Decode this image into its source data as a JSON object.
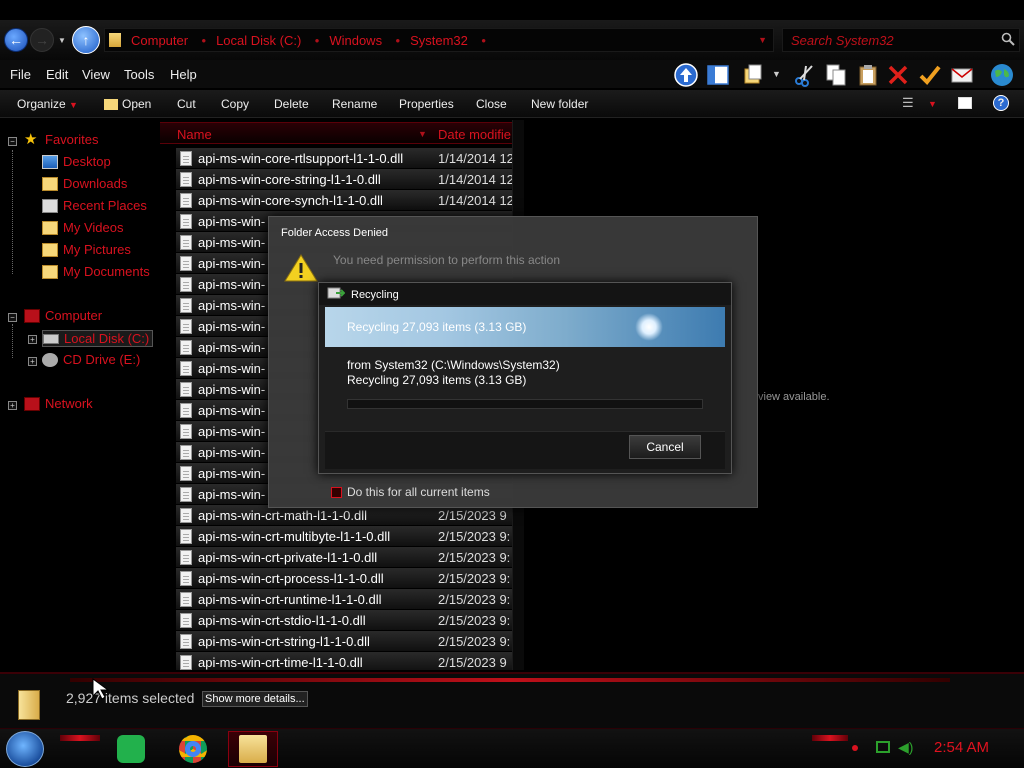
{
  "address": {
    "crumbs": [
      "Computer",
      "Local Disk (C:)",
      "Windows",
      "System32"
    ],
    "search_placeholder": "Search System32"
  },
  "menu": {
    "file": "File",
    "edit": "Edit",
    "view": "View",
    "tools": "Tools",
    "help": "Help"
  },
  "commands": {
    "organize": "Organize",
    "open": "Open",
    "cut": "Cut",
    "copy": "Copy",
    "delete": "Delete",
    "rename": "Rename",
    "properties": "Properties",
    "close": "Close",
    "new_folder": "New folder"
  },
  "nav": {
    "favorites": "Favorites",
    "desktop": "Desktop",
    "downloads": "Downloads",
    "recent_places": "Recent Places",
    "my_videos": "My Videos",
    "my_pictures": "My Pictures",
    "my_documents": "My Documents",
    "computer": "Computer",
    "local_disk": "Local Disk (C:)",
    "cd_drive": "CD Drive (E:)",
    "network": "Network"
  },
  "filelist": {
    "columns": {
      "name": "Name",
      "date": "Date modifie"
    },
    "rows": [
      {
        "name": "api-ms-win-core-rtlsupport-l1-1-0.dll",
        "date": "1/14/2014 12"
      },
      {
        "name": "api-ms-win-core-string-l1-1-0.dll",
        "date": "1/14/2014 12"
      },
      {
        "name": "api-ms-win-core-synch-l1-1-0.dll",
        "date": "1/14/2014 12"
      },
      {
        "name": "api-ms-win-",
        "date": ""
      },
      {
        "name": "api-ms-win-",
        "date": ""
      },
      {
        "name": "api-ms-win-",
        "date": ""
      },
      {
        "name": "api-ms-win-",
        "date": ""
      },
      {
        "name": "api-ms-win-",
        "date": ""
      },
      {
        "name": "api-ms-win-",
        "date": ""
      },
      {
        "name": "api-ms-win-",
        "date": ""
      },
      {
        "name": "api-ms-win-",
        "date": ""
      },
      {
        "name": "api-ms-win-",
        "date": ""
      },
      {
        "name": "api-ms-win-",
        "date": ""
      },
      {
        "name": "api-ms-win-",
        "date": ""
      },
      {
        "name": "api-ms-win-",
        "date": ""
      },
      {
        "name": "api-ms-win-",
        "date": ""
      },
      {
        "name": "api-ms-win-",
        "date": ""
      },
      {
        "name": "api-ms-win-crt-math-l1-1-0.dll",
        "date": "2/15/2023 9"
      },
      {
        "name": "api-ms-win-crt-multibyte-l1-1-0.dll",
        "date": "2/15/2023 9:"
      },
      {
        "name": "api-ms-win-crt-private-l1-1-0.dll",
        "date": "2/15/2023 9:"
      },
      {
        "name": "api-ms-win-crt-process-l1-1-0.dll",
        "date": "2/15/2023 9:"
      },
      {
        "name": "api-ms-win-crt-runtime-l1-1-0.dll",
        "date": "2/15/2023 9:"
      },
      {
        "name": "api-ms-win-crt-stdio-l1-1-0.dll",
        "date": "2/15/2023 9:"
      },
      {
        "name": "api-ms-win-crt-string-l1-1-0.dll",
        "date": "2/15/2023 9:"
      },
      {
        "name": "api-ms-win-crt-time-l1-1-0.dll",
        "date": "2/15/2023 9"
      }
    ]
  },
  "preview_note": "view available.",
  "access_dialog": {
    "title": "Folder Access Denied",
    "message": "You need permission to perform this action",
    "do_this": "Do this for all current items"
  },
  "recycle_dialog": {
    "title": "Recycling",
    "banner": "Recycling 27,093 items (3.13 GB)",
    "from": "from System32 (C:\\Windows\\System32)",
    "count": "Recycling 27,093 items (3.13 GB)",
    "progress": 0,
    "cancel": "Cancel"
  },
  "status": {
    "selected": "2,927 items selected",
    "more_details": "Show more details..."
  },
  "taskbar": {
    "clock": "2:54 AM"
  },
  "colors": {
    "accent": "#d9121f",
    "background": "#000000"
  }
}
